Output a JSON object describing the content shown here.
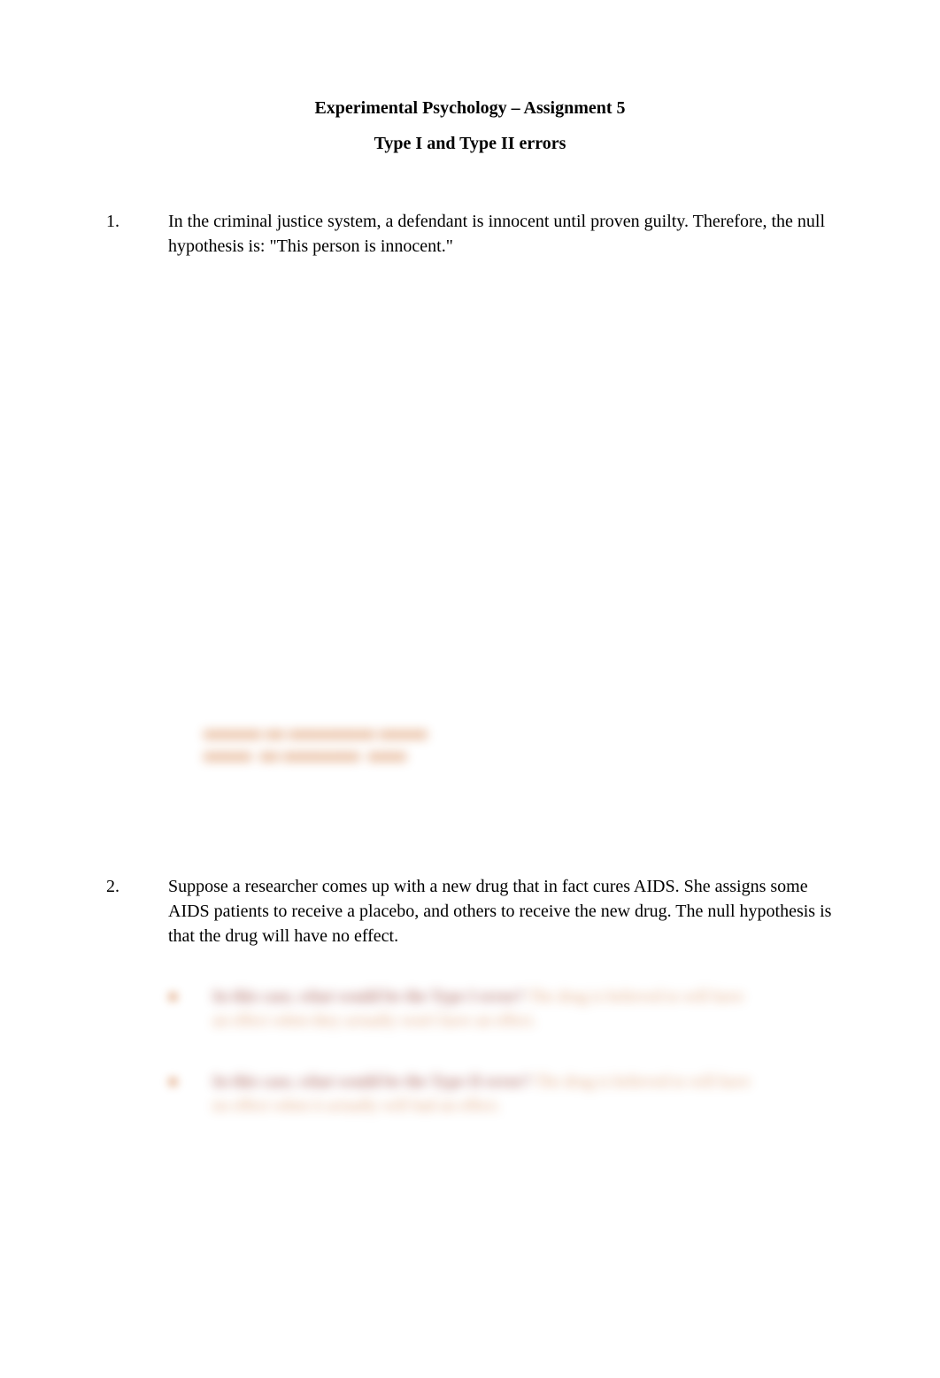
{
  "header": {
    "title": "Experimental Psychology – Assignment 5",
    "subtitle": "Type I and Type II errors"
  },
  "questions": {
    "q1": {
      "number": "1.",
      "text": "In the criminal justice system, a defendant is innocent until proven guilty. Therefore, the null hypothesis is: \"This person is innocent.\""
    },
    "q2": {
      "number": "2.",
      "text": "Suppose a researcher comes up with a new drug that in fact cures AIDS. She assigns some AIDS patients to receive a placebo, and others to receive the new drug. The null hypothesis is that the drug will have no effect."
    }
  },
  "obscured": {
    "mid_line1": "■■■■■■ ■■ ■■■■■■■■■ ■■■■■",
    "mid_line2": "■■■■■  ■■ ■■■■■■■■  ■■■■",
    "sub1_num": "■",
    "sub1_prompt": "In this case, what would be the Type I error?",
    "sub1_ans_a": "  The drug is believed to will have",
    "sub1_ans_b": "an effect when they actually won't have an effect.",
    "sub2_num": "■",
    "sub2_prompt": "In this case, what would be the Type II error?",
    "sub2_ans_a": "  The drug is believed to will have",
    "sub2_ans_b": "no effect when it actually will had an effect."
  }
}
